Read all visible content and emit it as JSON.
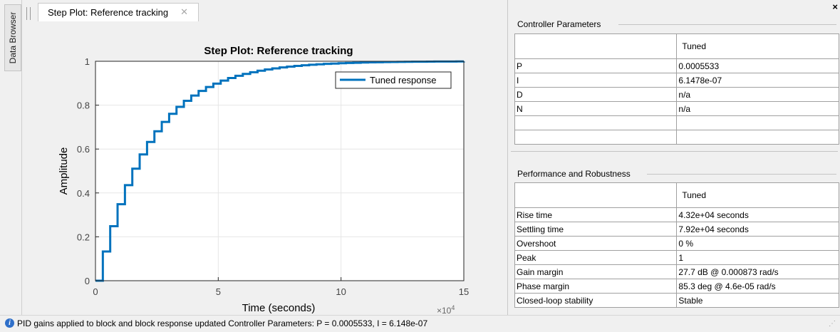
{
  "side_tab": {
    "label": "Data Browser"
  },
  "document_tab": {
    "label": "Step Plot: Reference tracking",
    "close_glyph": "✕"
  },
  "plot": {
    "legend_label": "Tuned response",
    "x_multiplier": "×10",
    "x_exponent": "4"
  },
  "chart_data": {
    "type": "line",
    "title": "Step Plot: Reference tracking",
    "xlabel": "Time (seconds)",
    "ylabel": "Amplitude",
    "xlim": [
      0,
      15
    ],
    "ylim": [
      0,
      1
    ],
    "x_ticks": [
      "0",
      "5",
      "10",
      "15"
    ],
    "y_ticks": [
      "0",
      "0.2",
      "0.4",
      "0.6",
      "0.8",
      "1"
    ],
    "grid": true,
    "legend_position": "top-right",
    "line_color": "#0072bd",
    "series": [
      {
        "name": "Tuned response",
        "style": "stairs",
        "sample_time": 0.3,
        "time_constant": 2.1,
        "final_value": 1
      }
    ]
  },
  "right_panel": {
    "close_glyph": "×",
    "controller": {
      "title": "Controller Parameters",
      "header": "Tuned",
      "rows": [
        {
          "name": "P",
          "value": "0.0005533"
        },
        {
          "name": "I",
          "value": "6.1478e-07"
        },
        {
          "name": "D",
          "value": "n/a"
        },
        {
          "name": "N",
          "value": "n/a"
        },
        {
          "name": "",
          "value": ""
        },
        {
          "name": "",
          "value": ""
        }
      ]
    },
    "performance": {
      "title": "Performance and Robustness",
      "header": "Tuned",
      "rows": [
        {
          "name": "Rise time",
          "value": "4.32e+04 seconds"
        },
        {
          "name": "Settling time",
          "value": "7.92e+04 seconds"
        },
        {
          "name": "Overshoot",
          "value": "0 %"
        },
        {
          "name": "Peak",
          "value": "1"
        },
        {
          "name": "Gain margin",
          "value": "27.7 dB @ 0.000873 rad/s"
        },
        {
          "name": "Phase margin",
          "value": "85.3 deg @ 4.6e-05 rad/s"
        },
        {
          "name": "Closed-loop stability",
          "value": "Stable"
        }
      ]
    }
  },
  "status_bar": {
    "icon": "info-icon",
    "text": "PID gains applied to block and block response updated   Controller Parameters: P = 0.0005533, I = 6.148e-07"
  }
}
